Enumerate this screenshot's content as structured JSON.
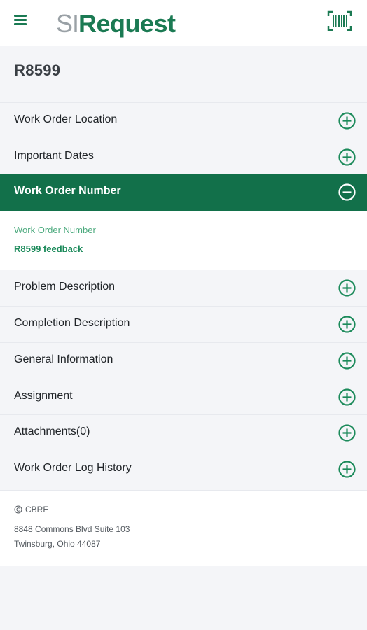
{
  "header": {
    "logo_si": "SI",
    "logo_request": "Request",
    "menu_icon": "hamburger-menu-icon",
    "scan_icon": "barcode-scan-icon"
  },
  "work_order": {
    "id": "R8599"
  },
  "sections": [
    {
      "label": "Work Order Location",
      "state": "collapsed"
    },
    {
      "label": "Important Dates",
      "state": "collapsed"
    },
    {
      "label": "Work Order Number",
      "state": "expanded"
    },
    {
      "label": "Problem Description",
      "state": "collapsed"
    },
    {
      "label": "Completion Description",
      "state": "collapsed"
    },
    {
      "label": "General Information",
      "state": "collapsed"
    },
    {
      "label": "Assignment",
      "state": "collapsed"
    },
    {
      "label": "Attachments(0)",
      "state": "collapsed"
    },
    {
      "label": "Work Order Log History",
      "state": "collapsed"
    }
  ],
  "expanded_detail": {
    "field_label": "Work Order Number",
    "field_value": "R8599 feedback"
  },
  "footer": {
    "company": "CBRE",
    "address_line1": "8848 Commons Blvd Suite 103",
    "address_line2": "Twinsburg, Ohio 44087"
  },
  "colors": {
    "brand_green": "#1b7a53",
    "active_row": "#12704a",
    "background": "#f4f5f8",
    "logo_gray": "#9aa1a6"
  }
}
